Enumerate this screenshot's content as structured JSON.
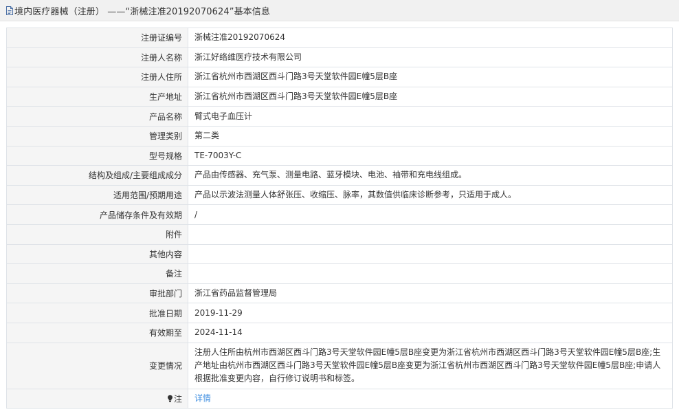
{
  "header": {
    "title": "境内医疗器械（注册） ——“浙械注准20192070624”基本信息"
  },
  "rows": [
    {
      "label": "注册证编号",
      "value": "浙械注准20192070624"
    },
    {
      "label": "注册人名称",
      "value": "浙江好络维医疗技术有限公司"
    },
    {
      "label": "注册人住所",
      "value": "浙江省杭州市西湖区西斗门路3号天堂软件园E幢5层B座"
    },
    {
      "label": "生产地址",
      "value": "浙江省杭州市西湖区西斗门路3号天堂软件园E幢5层B座"
    },
    {
      "label": "产品名称",
      "value": "臂式电子血压计"
    },
    {
      "label": "管理类别",
      "value": "第二类"
    },
    {
      "label": "型号规格",
      "value": "TE-7003Y-C"
    },
    {
      "label": "结构及组成/主要组成成分",
      "value": "产品由传感器、充气泵、测量电路、蓝牙模块、电池、袖带和充电线组成。"
    },
    {
      "label": "适用范围/预期用途",
      "value": "产品以示波法测量人体舒张压、收缩压、脉率，其数值供临床诊断参考，只适用于成人。"
    },
    {
      "label": "产品储存条件及有效期",
      "value": "/"
    },
    {
      "label": "附件",
      "value": ""
    },
    {
      "label": "其他内容",
      "value": ""
    },
    {
      "label": "备注",
      "value": ""
    },
    {
      "label": "审批部门",
      "value": "浙江省药品监督管理局"
    },
    {
      "label": "批准日期",
      "value": "2019-11-29"
    },
    {
      "label": "有效期至",
      "value": "2024-11-14"
    },
    {
      "label": "变更情况",
      "value": "注册人住所由杭州市西湖区西斗门路3号天堂软件园E幢5层B座变更为浙江省杭州市西湖区西斗门路3号天堂软件园E幢5层B座;生产地址由杭州市西湖区西斗门路3号天堂软件园E幢5层B座变更为浙江省杭州市西湖区西斗门路3号天堂软件园E幢5层B座;申请人根据批准变更内容，自行修订说明书和标签。"
    }
  ],
  "note": {
    "label": "注",
    "link_text": "详情",
    "icon": "lightbulb-icon"
  },
  "colors": {
    "link": "#3c8de0",
    "label_bg": "#f5f5f5",
    "border": "#dfe3e8",
    "header_bg": "#f1f1f1"
  }
}
